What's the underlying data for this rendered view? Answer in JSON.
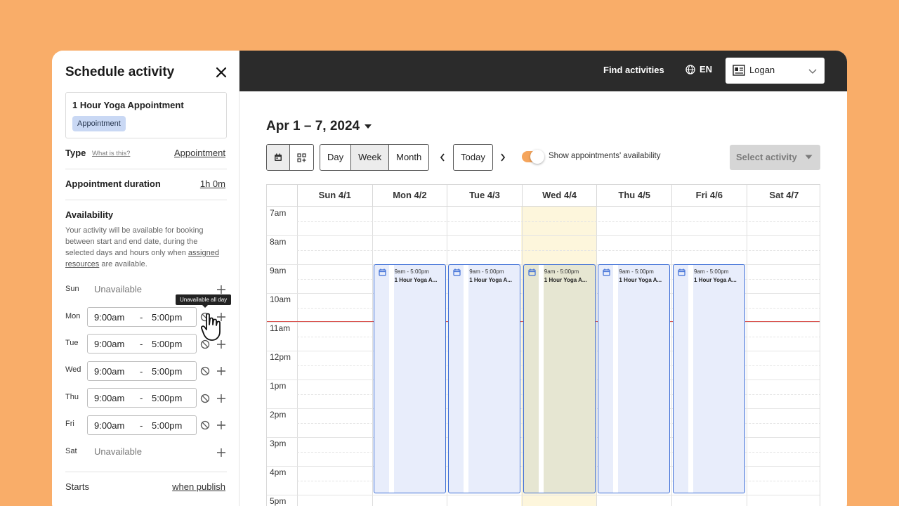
{
  "panel": {
    "title": "Schedule activity",
    "card_title": "1 Hour Yoga Appointment",
    "card_badge": "Appointment",
    "type_label": "Type",
    "type_help": "What is this?",
    "type_value": "Appointment",
    "duration_label": "Appointment duration",
    "duration_value": "1h 0m",
    "availability_label": "Availability",
    "availability_desc_1": "Your activity will be available for booking between start and end date, during the selected days and hours only when",
    "availability_link": "assigned resources",
    "availability_desc_2": "are available.",
    "tooltip": "Unavailable all day",
    "days": [
      {
        "day": "Sun",
        "unavailable": "Unavailable"
      },
      {
        "day": "Mon",
        "start": "9:00am",
        "dash": "-",
        "end": "5:00pm"
      },
      {
        "day": "Tue",
        "start": "9:00am",
        "dash": "-",
        "end": "5:00pm"
      },
      {
        "day": "Wed",
        "start": "9:00am",
        "dash": "-",
        "end": "5:00pm"
      },
      {
        "day": "Thu",
        "start": "9:00am",
        "dash": "-",
        "end": "5:00pm"
      },
      {
        "day": "Fri",
        "start": "9:00am",
        "dash": "-",
        "end": "5:00pm"
      },
      {
        "day": "Sat",
        "unavailable": "Unavailable"
      }
    ],
    "starts_label": "Starts",
    "starts_value": "when publish"
  },
  "topbar": {
    "find_activities": "Find activities",
    "language": "EN",
    "user_name": "Logan"
  },
  "calendar": {
    "date_range": "Apr 1 – 7, 2024",
    "modes": [
      "Day",
      "Week",
      "Month"
    ],
    "selected_mode": "Week",
    "today_label": "Today",
    "toggle_label": "Show appointments' availability",
    "toggle_on": true,
    "select_activity_label": "Select activity",
    "day_headers": [
      "Sun 4/1",
      "Mon 4/2",
      "Tue 4/3",
      "Wed 4/4",
      "Thu 4/5",
      "Fri 4/6",
      "Sat 4/7"
    ],
    "highlighted_day": "Wed 4/4",
    "hours": [
      "7am",
      "8am",
      "9am",
      "10am",
      "11am",
      "12pm",
      "1pm",
      "2pm",
      "3pm",
      "4pm",
      "5pm"
    ],
    "events": [
      {
        "day": "Mon 4/2",
        "time": "9am - 5:00pm",
        "title": "1 Hour Yoga A..."
      },
      {
        "day": "Tue 4/3",
        "time": "9am - 5:00pm",
        "title": "1 Hour Yoga A..."
      },
      {
        "day": "Wed 4/4",
        "time": "9am - 5:00pm",
        "title": "1 Hour Yoga A..."
      },
      {
        "day": "Thu 4/5",
        "time": "9am - 5:00pm",
        "title": "1 Hour Yoga A..."
      },
      {
        "day": "Fri 4/6",
        "time": "9am - 5:00pm",
        "title": "1 Hour Yoga A..."
      }
    ]
  },
  "colors": {
    "background": "#f9ad69",
    "topbar": "#2b2b2b",
    "event_border": "#3d6ed6",
    "event_fill": "#e8edfb",
    "today_column": "#fdf6dc",
    "now_line": "#d9534f",
    "toggle_on": "#f5a55c"
  }
}
